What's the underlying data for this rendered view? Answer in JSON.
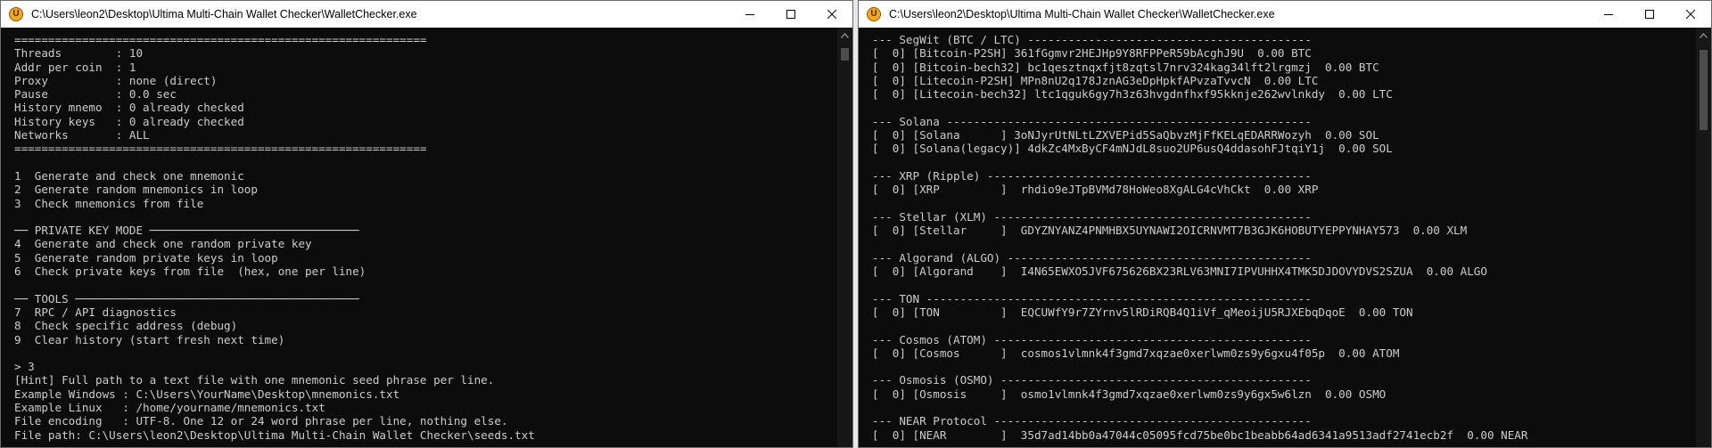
{
  "left": {
    "title": "C:\\Users\\leon2\\Desktop\\Ultima Multi-Chain Wallet Checker\\WalletChecker.exe",
    "lines": [
      "=============================================================",
      "Threads        : 10",
      "Addr per coin  : 1",
      "Proxy          : none (direct)",
      "Pause          : 0.0 sec",
      "History mnemo  : 0 already checked",
      "History keys   : 0 already checked",
      "Networks       : ALL",
      "=============================================================",
      "",
      "1  Generate and check one mnemonic",
      "2  Generate random mnemonics in loop",
      "3  Check mnemonics from file",
      "",
      "── PRIVATE KEY MODE ───────────────────────────────",
      "4  Generate and check one random private key",
      "5  Generate random private keys in loop",
      "6  Check private keys from file  (hex, one per line)",
      "",
      "── TOOLS ──────────────────────────────────────────",
      "7  RPC / API diagnostics",
      "8  Check specific address (debug)",
      "9  Clear history (start fresh next time)",
      "",
      "> 3",
      "[Hint] Full path to a text file with one mnemonic seed phrase per line.",
      "Example Windows : C:\\Users\\YourName\\Desktop\\mnemonics.txt",
      "Example Linux   : /home/yourname/mnemonics.txt",
      "File encoding   : UTF-8. One 12 or 24 word phrase per line, nothing else.",
      "File path: C:\\Users\\leon2\\Desktop\\Ultima Multi-Chain Wallet Checker\\seeds.txt"
    ]
  },
  "right": {
    "title": "C:\\Users\\leon2\\Desktop\\Ultima Multi-Chain Wallet Checker\\WalletChecker.exe",
    "lines": [
      "--- SegWit (BTC / LTC) ------------------------------------------",
      "[  0] [Bitcoin-P2SH] 361fGgmvr2HEJHp9Y8RFPPeR59bAcghJ9U  0.00 BTC",
      "[  0] [Bitcoin-bech32] bc1qesztnqxfjt8zqtsl7nrv324kag34lft2lrgmzj  0.00 BTC",
      "[  0] [Litecoin-P2SH] MPn8nU2q178JznAG3eDpHpkfAPvzaTvvcN  0.00 LTC",
      "[  0] [Litecoin-bech32] ltc1qguk6gy7h3z63hvgdnfhxf95kknje262wvlnkdy  0.00 LTC",
      "",
      "--- Solana ------------------------------------------------------",
      "[  0] [Solana      ] 3oNJyrUtNLtLZXVEPid5SaQbvzMjFfKELqEDARRWozyh  0.00 SOL",
      "[  0] [Solana(legacy)] 4dkZc4MxByCF4mNJdL8suo2UP6usQ4ddasohFJtqiY1j  0.00 SOL",
      "",
      "--- XRP (Ripple) ------------------------------------------------",
      "[  0] [XRP         ]  rhdio9eJTpBVMd78HoWeo8XgALG4cVhCkt  0.00 XRP",
      "",
      "--- Stellar (XLM) -----------------------------------------------",
      "[  0] [Stellar     ]  GDYZNYANZ4PNMHBX5UYNAWI2OICRNVMT7B3GJK6HOBUTYEPPYNHAY573  0.00 XLM",
      "",
      "--- Algorand (ALGO) ---------------------------------------------",
      "[  0] [Algorand    ]  I4N65EWXO5JVF675626BX23RLV63MNI7IPVUHHX4TMK5DJDOVYDVS2SZUA  0.00 ALGO",
      "",
      "--- TON ---------------------------------------------------------",
      "[  0] [TON         ]  EQCUWfY9r7ZYrnv5lRDiRQB4Q1iVf_qMeoijU5RJXEbqDqoE  0.00 TON",
      "",
      "--- Cosmos (ATOM) -----------------------------------------------",
      "[  0] [Cosmos      ]  cosmos1vlmnk4f3gmd7xqzae0xerlwm0zs9y6gxu4f05p  0.00 ATOM",
      "",
      "--- Osmosis (OSMO) ----------------------------------------------",
      "[  0] [Osmosis     ]  osmo1vlmnk4f3gmd7xqzae0xerlwm0zs9y6gx5w6lzn  0.00 OSMO",
      "",
      "--- NEAR Protocol -----------------------------------------------",
      "[  0] [NEAR        ]  35d7ad14bb0a47044c05095fcd75be0bc1beabb64ad6341a9513adf2741ecb2f  0.00 NEAR"
    ]
  }
}
